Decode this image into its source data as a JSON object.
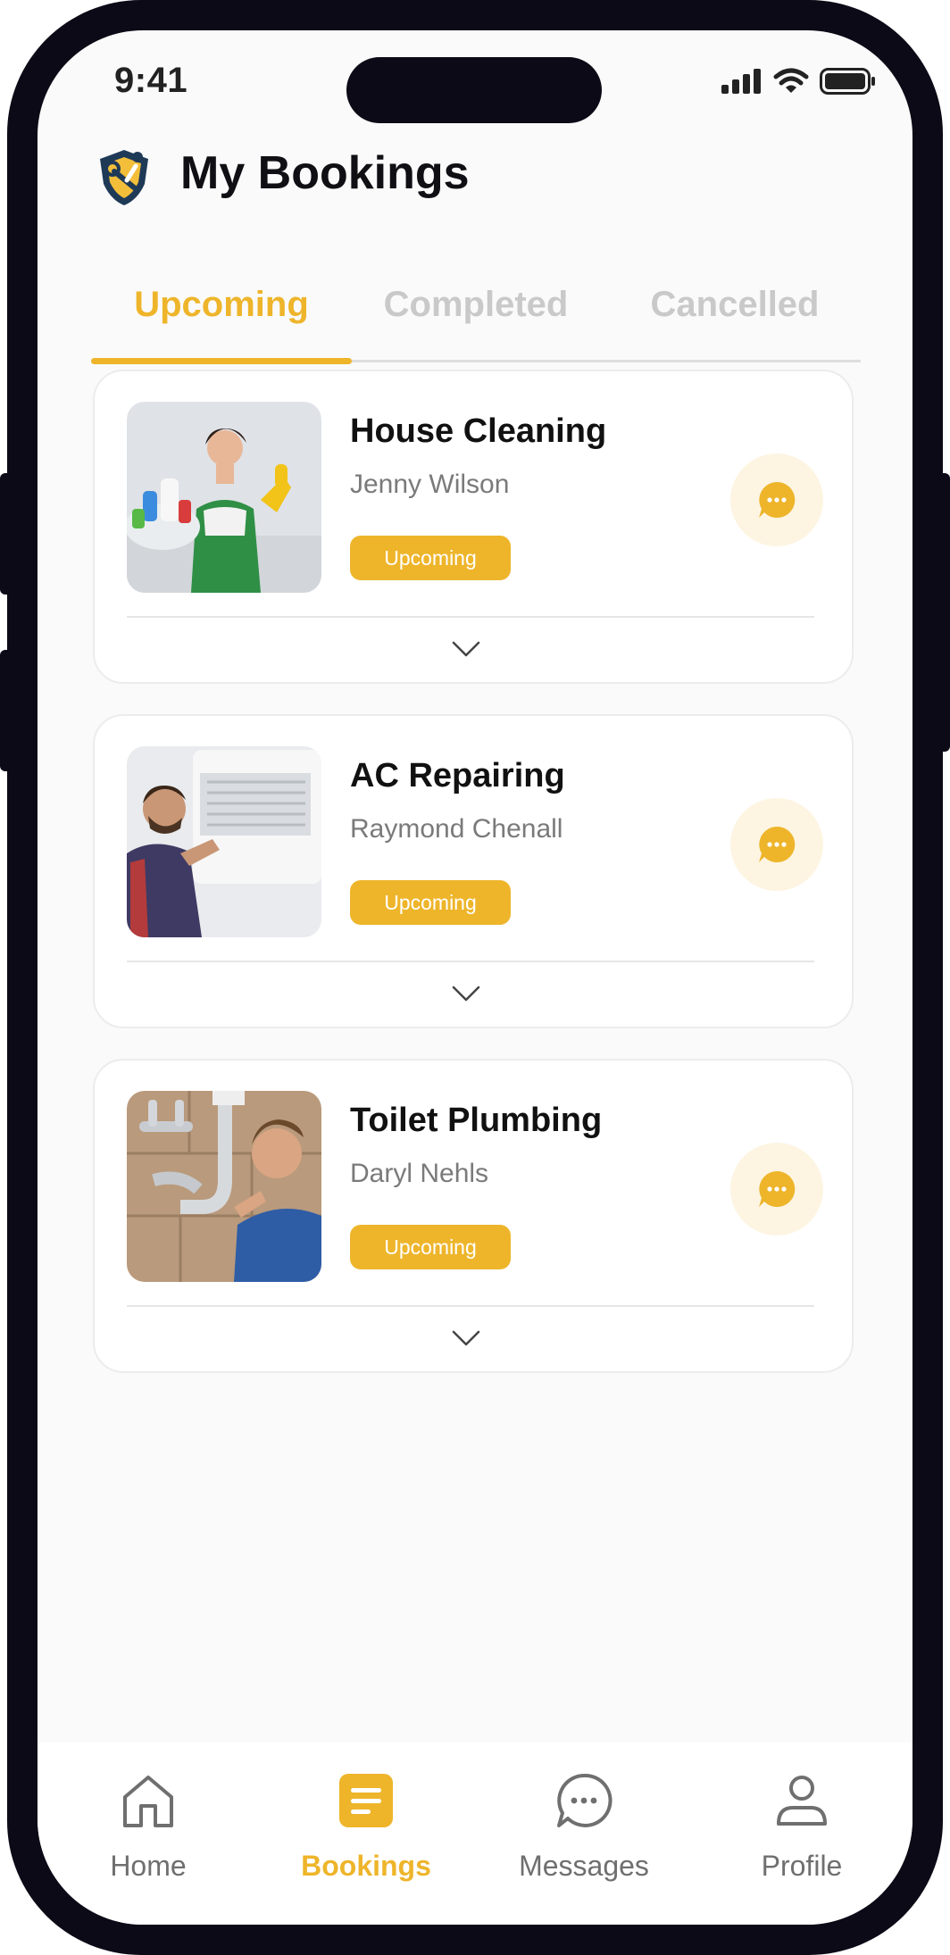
{
  "status_bar": {
    "time": "9:41"
  },
  "header": {
    "title": "My Bookings"
  },
  "tabs": [
    {
      "label": "Upcoming",
      "active": true
    },
    {
      "label": "Completed",
      "active": false
    },
    {
      "label": "Cancelled",
      "active": false
    }
  ],
  "bookings": [
    {
      "service": "House Cleaning",
      "provider": "Jenny Wilson",
      "status": "Upcoming"
    },
    {
      "service": "AC Repairing",
      "provider": "Raymond Chenall",
      "status": "Upcoming"
    },
    {
      "service": "Toilet Plumbing",
      "provider": "Daryl Nehls",
      "status": "Upcoming"
    }
  ],
  "bottom_nav": [
    {
      "label": "Home",
      "icon": "home-icon",
      "active": false
    },
    {
      "label": "Bookings",
      "icon": "bookings-icon",
      "active": true
    },
    {
      "label": "Messages",
      "icon": "messages-icon",
      "active": false
    },
    {
      "label": "Profile",
      "icon": "profile-icon",
      "active": false
    }
  ],
  "colors": {
    "accent": "#eeb52b",
    "chat_bg": "#fdf5e2",
    "frame": "#0b0a16",
    "inactive_tab": "#c9c9c9"
  }
}
